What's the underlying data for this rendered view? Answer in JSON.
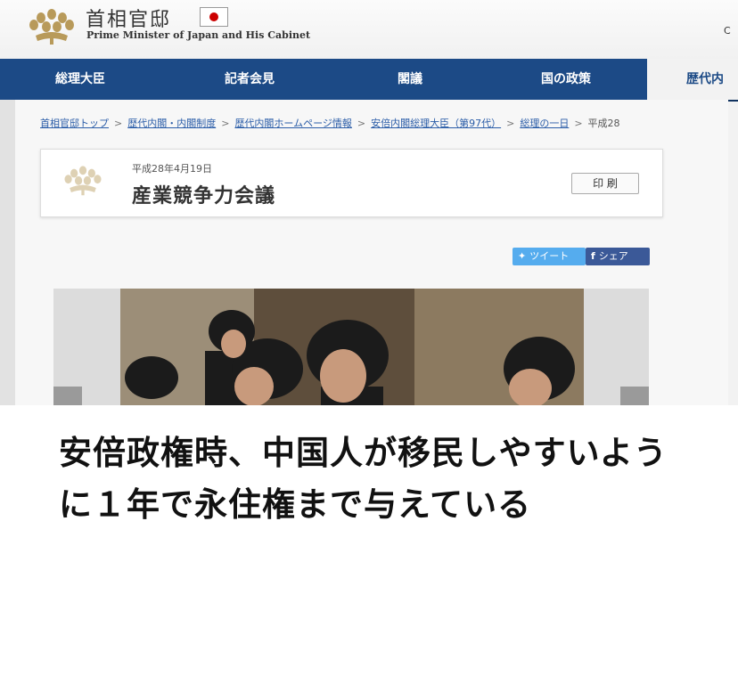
{
  "header": {
    "site_title": "首相官邸",
    "site_subtitle": "Prime Minister of Japan and His Cabinet",
    "right_edge_text": "C"
  },
  "nav": {
    "items": [
      "総理大臣",
      "記者会見",
      "閣議",
      "国の政策",
      "歴代内"
    ]
  },
  "breadcrumb": {
    "items": [
      "首相官邸トップ",
      "歴代内閣・内閣制度",
      "歴代内閣ホームページ情報",
      "安倍内閣総理大臣（第97代）",
      "総理の一日",
      "平成28"
    ]
  },
  "article": {
    "date": "平成28年4月19日",
    "title": "産業競争力会議",
    "print_label": "印 刷"
  },
  "share": {
    "tweet_label": "ツイート",
    "facebook_label": "シェア"
  },
  "caption": {
    "text": "安倍政権時、中国人が移民しやすいように１年で永住権まで与えている"
  },
  "colors": {
    "nav_bg": "#1c4a86",
    "twitter": "#55acee",
    "facebook": "#3b5998"
  }
}
